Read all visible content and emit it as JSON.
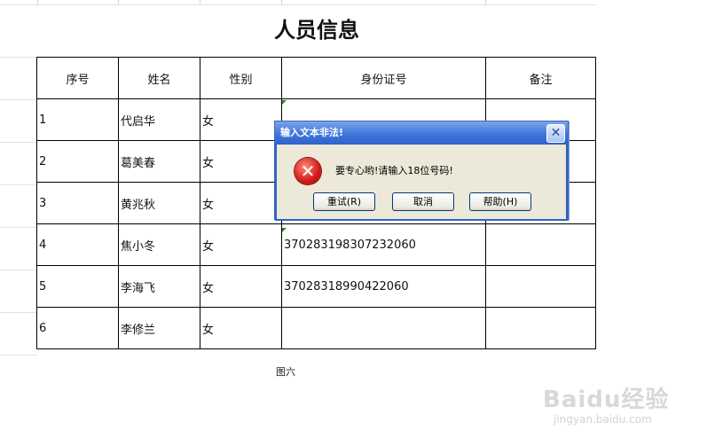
{
  "sheet": {
    "title": "人员信息",
    "headers": [
      "序号",
      "姓名",
      "性别",
      "身份证号",
      "备注"
    ],
    "rows": [
      {
        "no": "1",
        "name": "代启华",
        "gender": "女",
        "id": "",
        "note": ""
      },
      {
        "no": "2",
        "name": "葛美春",
        "gender": "女",
        "id": "",
        "note": ""
      },
      {
        "no": "3",
        "name": "黄兆秋",
        "gender": "女",
        "id": "",
        "note": ""
      },
      {
        "no": "4",
        "name": "焦小冬",
        "gender": "女",
        "id": "370283198307232060",
        "note": ""
      },
      {
        "no": "5",
        "name": "李海飞",
        "gender": "女",
        "id": "37028318990422060",
        "note": ""
      },
      {
        "no": "6",
        "name": "李修兰",
        "gender": "女",
        "id": "",
        "note": ""
      }
    ],
    "caption": "图六"
  },
  "dialog": {
    "title": "输入文本非法!",
    "message": "要专心哟!请输入18位号码!",
    "buttons": {
      "retry": "重试(R)",
      "cancel": "取消",
      "help": "帮助(H)"
    },
    "close_glyph": "✕",
    "icon": "error-icon"
  },
  "watermark": {
    "brand": "Baidu经验",
    "url": "jingyan.baidu.com"
  }
}
